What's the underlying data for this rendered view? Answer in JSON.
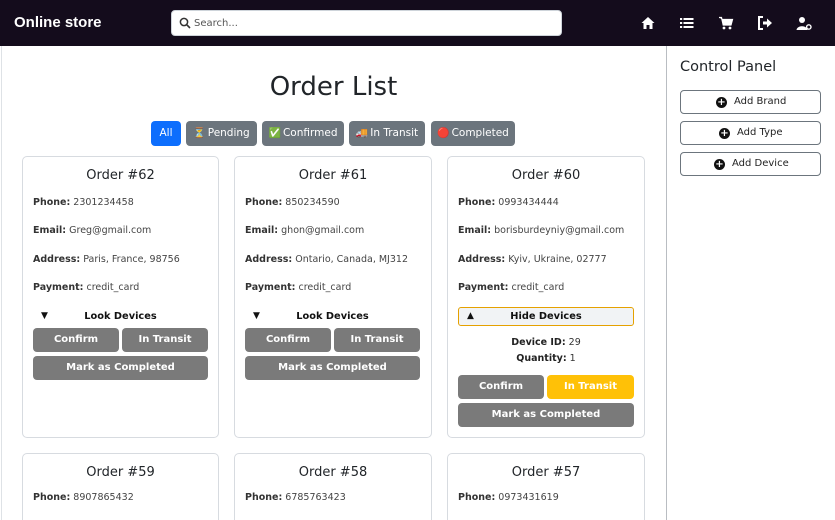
{
  "navbar": {
    "brand": "Online store",
    "search_placeholder": "Search...",
    "icons": [
      "home-icon",
      "list-icon",
      "cart-icon",
      "logout-icon",
      "admin-user-icon"
    ]
  },
  "main": {
    "title": "Order List",
    "filters": [
      {
        "label": "All",
        "emoji": "",
        "active": true
      },
      {
        "label": "Pending",
        "emoji": "⏳",
        "active": false
      },
      {
        "label": "Confirmed",
        "emoji": "✅",
        "active": false
      },
      {
        "label": "In Transit",
        "emoji": "🚚",
        "active": false
      },
      {
        "label": "Completed",
        "emoji": "🔴",
        "active": false
      }
    ],
    "labels": {
      "phone": "Phone:",
      "email": "Email:",
      "address": "Address:",
      "payment": "Payment:",
      "look_devices": "Look Devices",
      "hide_devices": "Hide Devices",
      "device_id": "Device ID:",
      "quantity": "Quantity:",
      "confirm": "Confirm",
      "in_transit": "In Transit",
      "mark_completed": "Mark as Completed"
    },
    "orders": [
      {
        "title": "Order #62",
        "phone": "2301234458",
        "email": "Greg@gmail.com",
        "address": "Paris, France, 98756",
        "payment": "credit_card",
        "arrow": "▼"
      },
      {
        "title": "Order #61",
        "phone": "850234590",
        "email": "ghon@gmail.com",
        "address": "Ontario, Canada, MJ312",
        "payment": "credit_card",
        "arrow": "▼"
      },
      {
        "title": "Order #60",
        "phone": "0993434444",
        "email": "borisburdeyniy@gmail.com",
        "address": "Kyiv, Ukraine, 02777",
        "payment": "credit_card",
        "arrow": "▲",
        "device_id": "29",
        "quantity": "1"
      },
      {
        "title": "Order #59",
        "phone": "8907865432"
      },
      {
        "title": "Order #58",
        "phone": "6785763423"
      },
      {
        "title": "Order #57",
        "phone": "0973431619"
      }
    ]
  },
  "panel": {
    "title": "Control Panel",
    "buttons": [
      "Add Brand",
      "Add Type",
      "Add Device"
    ]
  },
  "colors": {
    "navbar_bg": "#140c1c",
    "primary": "#0d6efd",
    "secondary": "#6c757d",
    "button_gray": "#7a7a7a",
    "warning": "#ffc107"
  }
}
